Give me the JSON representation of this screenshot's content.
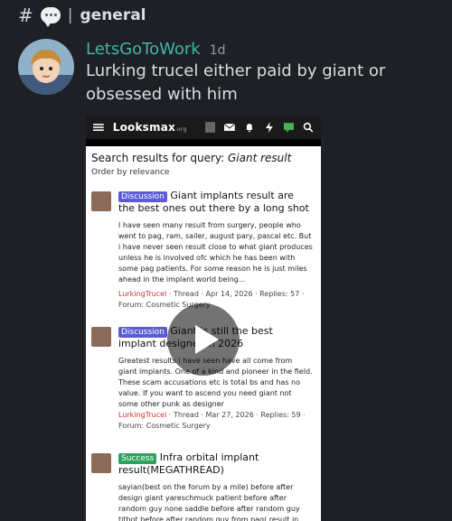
{
  "channel": {
    "hash": "#",
    "separator": "|",
    "name": "general",
    "icon": "speech-bubble-icon"
  },
  "message": {
    "username": "LetsGoToWork",
    "time": "1d",
    "text": "Lurking trucel either paid by giant or obsessed with him"
  },
  "embed": {
    "logo": "Looksmax",
    "logo_suffix": ".org",
    "search_title_prefix": "Search results for query: ",
    "search_query": "Giant result",
    "order": "Order by relevance",
    "results": [
      {
        "badge": "Discussion",
        "title": "Giant implants result are the best ones out there by a long shot",
        "body": "I have seen many result from surgery, people who went to pag, ram, sailer, august pary, pascal etc. But i have never seen result close to what giant produces unless he is involved ofc which he has been with some pag patients. For some reason he is just miles ahead in the implant world being...",
        "author": "LurkingTrucel",
        "meta": " · Thread · Apr 14, 2026 · Replies: 57 · Forum: Cosmetic Surgery"
      },
      {
        "badge": "Discussion",
        "title": "Giant is still the best implant designer in 2026",
        "body": "Greatest results i have seen have all come from giant implants. One of a kind and pioneer in the field. These scam accusations etc is total bs and has no value. If you want to ascend you need giant not some other punk as designer",
        "author": "LurkingTrucel",
        "meta": " · Thread · Mar 27, 2026 · Replies: 59 · Forum: Cosmetic Surgery"
      },
      {
        "badge": "Success",
        "title": "Infra orbital implant result(MEGATHREAD)",
        "body": "sayian(best on the forum by a mile) before after design giant yareschmuck patient before after random guy none saddle before after random guy titbot before after random guy from pag( result in reverse order) after..."
      }
    ]
  },
  "colors": {
    "username": "#43b5a6",
    "background": "#1f2026"
  }
}
